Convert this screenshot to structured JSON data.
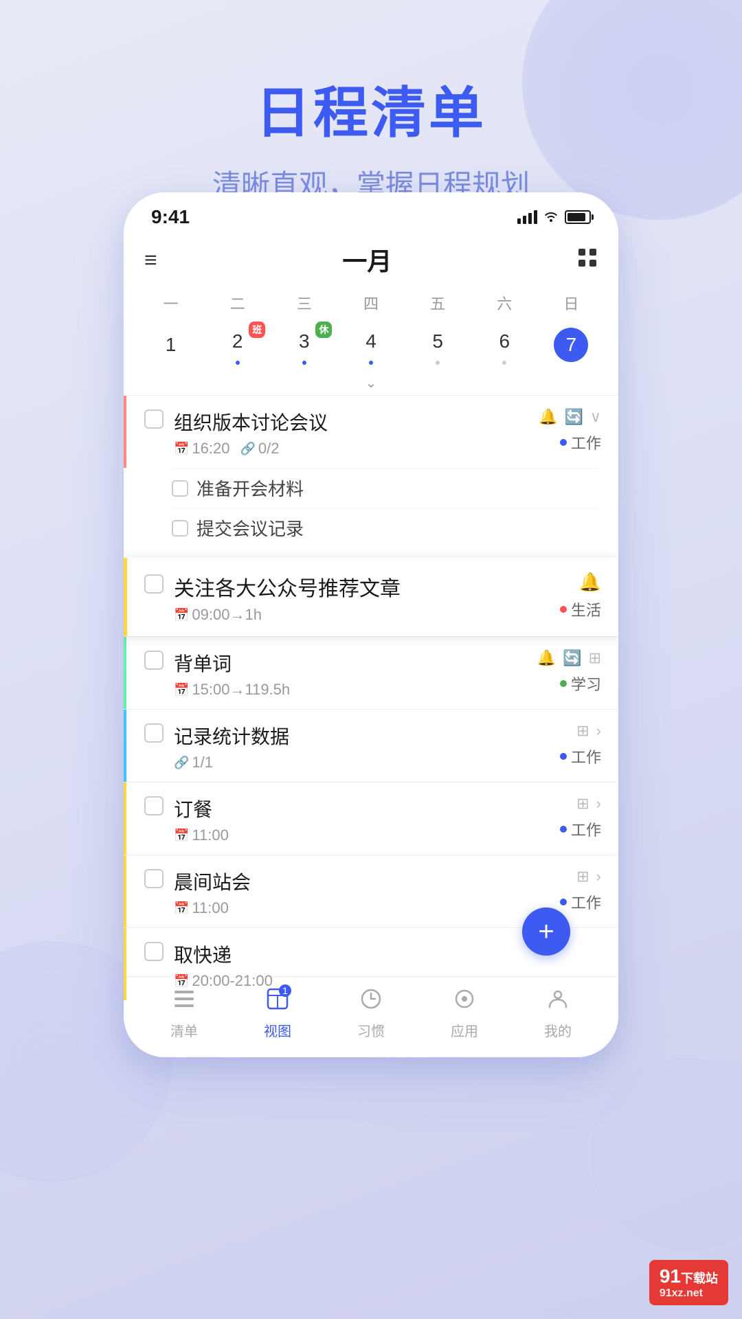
{
  "background": {
    "gradient_start": "#e8eaf6",
    "gradient_end": "#cdd0ee"
  },
  "header": {
    "title": "日程清单",
    "subtitle": "清晰直观，掌握日程规划"
  },
  "phone": {
    "status_bar": {
      "time": "9:41"
    },
    "calendar": {
      "month": "一月",
      "week_days": [
        "一",
        "二",
        "三",
        "四",
        "五",
        "六",
        "日"
      ],
      "dates": [
        {
          "num": "1",
          "dot": false,
          "badge": null
        },
        {
          "num": "2",
          "dot": true,
          "dot_color": "blue",
          "badge": {
            "text": "班",
            "color": "red"
          }
        },
        {
          "num": "3",
          "dot": true,
          "dot_color": "blue",
          "badge": {
            "text": "休",
            "color": "green"
          }
        },
        {
          "num": "4",
          "dot": true,
          "dot_color": "blue",
          "badge": null
        },
        {
          "num": "5",
          "dot": true,
          "dot_color": "gray",
          "badge": null
        },
        {
          "num": "6",
          "dot": true,
          "dot_color": "gray",
          "badge": null
        },
        {
          "num": "7",
          "dot": false,
          "selected": true,
          "badge": null
        }
      ]
    },
    "tasks": [
      {
        "id": 1,
        "title": "组织版本讨论会议",
        "time": "16:20",
        "subtask_count": "0/2",
        "tag": "工作",
        "tag_color": "blue",
        "border_color": "pink",
        "expanded": true,
        "sub_tasks": [
          "准备开会材料",
          "提交会议记录"
        ]
      },
      {
        "id": 2,
        "title": "关注各大公众号推荐文章",
        "time": "09:00→1h",
        "tag": "生活",
        "tag_color": "red",
        "border_color": "yellow",
        "highlighted": true
      },
      {
        "id": 3,
        "title": "背单词",
        "time": "15:00→119.5h",
        "tag": "学习",
        "tag_color": "green",
        "border_color": "green"
      },
      {
        "id": 4,
        "title": "记录统计数据",
        "subtask_count": "1/1",
        "tag": "工作",
        "tag_color": "blue",
        "border_color": "blue"
      },
      {
        "id": 5,
        "title": "订餐",
        "time": "11:00",
        "tag": "工作",
        "tag_color": "blue",
        "border_color": "yellow"
      },
      {
        "id": 6,
        "title": "晨间站会",
        "time": "11:00",
        "tag": "工作",
        "tag_color": "blue",
        "border_color": "yellow"
      },
      {
        "id": 7,
        "title": "取快递",
        "time": "20:00-21:00",
        "tag": "",
        "border_color": "yellow"
      }
    ],
    "nav": {
      "items": [
        {
          "label": "清单",
          "icon": "☰",
          "active": false
        },
        {
          "label": "视图",
          "icon": "◫",
          "active": true,
          "badge": "1"
        },
        {
          "label": "习惯",
          "icon": "⏱",
          "active": false
        },
        {
          "label": "应用",
          "icon": "◎",
          "active": false
        },
        {
          "label": "我的",
          "icon": "☺",
          "active": false
        }
      ]
    }
  },
  "watermark": {
    "line1": "91",
    "line2": "下载站",
    "line3": "91xz.net"
  }
}
